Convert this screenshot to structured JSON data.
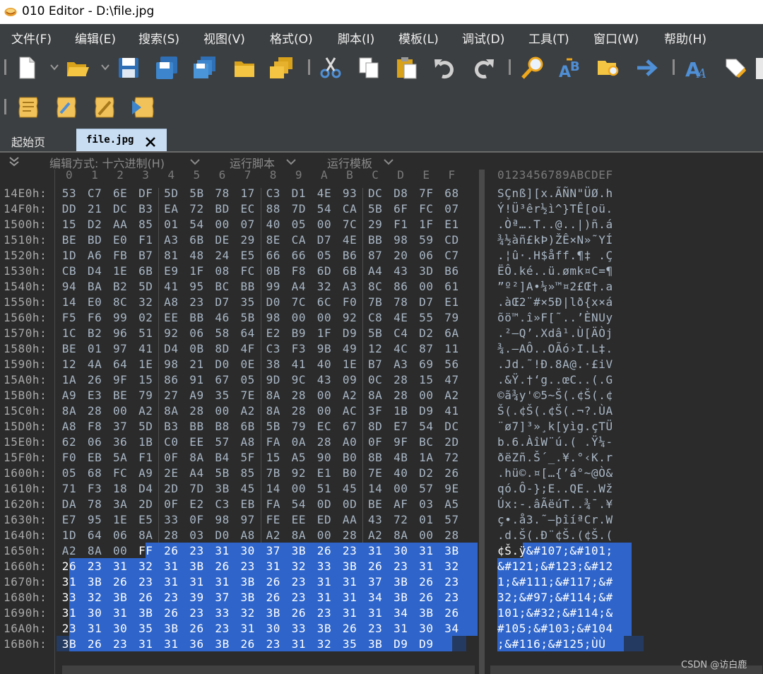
{
  "window": {
    "title": "010 Editor - D:\\file.jpg"
  },
  "menu": [
    "文件(F)",
    "编辑(E)",
    "搜索(S)",
    "视图(V)",
    "格式(O)",
    "脚本(I)",
    "模板(L)",
    "调试(D)",
    "工具(T)",
    "窗口(W)",
    "帮助(H)"
  ],
  "toolbar": {
    "row1": [
      "new-file-icon",
      "open-folder-icon",
      "save-icon",
      "save-as-icon",
      "save-all-icon",
      "folder-icon",
      "open-workspace-icon",
      "cut-icon",
      "copy-icon",
      "paste-icon",
      "undo-icon",
      "redo-icon",
      "find-icon",
      "replace-icon",
      "find-in-files-icon",
      "goto-icon",
      "font-icon",
      "highlight-icon"
    ],
    "row2": [
      "run-script-icon",
      "script-edit-icon",
      "template-icon",
      "run-template-icon"
    ]
  },
  "tabs": {
    "home": "起始页",
    "file": "file.jpg"
  },
  "editor": {
    "edit_mode": "编辑方式: 十六进制(H)",
    "run_script": "运行脚本",
    "run_template": "运行模板",
    "hex_header": [
      "0",
      "1",
      "2",
      "3",
      "4",
      "5",
      "6",
      "7",
      "8",
      "9",
      "A",
      "B",
      "C",
      "D",
      "E",
      "F"
    ],
    "ascii_header": "0123456789ABCDEF",
    "rows": [
      {
        "addr": "14E0h:",
        "hex": [
          "53",
          "C7",
          "6E",
          "DF",
          "5D",
          "5B",
          "78",
          "17",
          "C3",
          "D1",
          "4E",
          "93",
          "DC",
          "D8",
          "7F",
          "68"
        ],
        "ascii": "SÇnß][x.ÃÑN\"ÜØ.h"
      },
      {
        "addr": "14F0h:",
        "hex": [
          "DD",
          "21",
          "DC",
          "B3",
          "EA",
          "72",
          "BD",
          "EC",
          "88",
          "7D",
          "54",
          "CA",
          "5B",
          "6F",
          "FC",
          "07"
        ],
        "ascii": "Ý!Ü³êr½ì^}TÊ[oü."
      },
      {
        "addr": "1500h:",
        "hex": [
          "15",
          "D2",
          "AA",
          "85",
          "01",
          "54",
          "00",
          "07",
          "40",
          "05",
          "00",
          "7C",
          "29",
          "F1",
          "1F",
          "E1"
        ],
        "ascii": ".Òª….T..@..|)ñ.á"
      },
      {
        "addr": "1510h:",
        "hex": [
          "BE",
          "BD",
          "E0",
          "F1",
          "A3",
          "6B",
          "DE",
          "29",
          "8E",
          "CA",
          "D7",
          "4E",
          "BB",
          "98",
          "59",
          "CD"
        ],
        "ascii": "¾½àñ£kÞ)ŽÊ×N»˜YÍ"
      },
      {
        "addr": "1520h:",
        "hex": [
          "1D",
          "A6",
          "FB",
          "B7",
          "81",
          "48",
          "24",
          "E5",
          "66",
          "66",
          "05",
          "B6",
          "87",
          "20",
          "06",
          "C7"
        ],
        "ascii": ".¦û·.H$åff.¶‡ .Ç"
      },
      {
        "addr": "1530h:",
        "hex": [
          "CB",
          "D4",
          "1E",
          "6B",
          "E9",
          "1F",
          "08",
          "FC",
          "0B",
          "F8",
          "6D",
          "6B",
          "A4",
          "43",
          "3D",
          "B6"
        ],
        "ascii": "ËÔ.ké..ü.ømk¤C=¶"
      },
      {
        "addr": "1540h:",
        "hex": [
          "94",
          "BA",
          "B2",
          "5D",
          "41",
          "95",
          "BC",
          "BB",
          "99",
          "A4",
          "32",
          "A3",
          "8C",
          "86",
          "00",
          "61"
        ],
        "ascii": "”º²]A•¼»™¤2£Œ†.a"
      },
      {
        "addr": "1550h:",
        "hex": [
          "14",
          "E0",
          "8C",
          "32",
          "A8",
          "23",
          "D7",
          "35",
          "D0",
          "7C",
          "6C",
          "F0",
          "7B",
          "78",
          "D7",
          "E1"
        ],
        "ascii": ".àŒ2¨#×5Ð|lð{x×á"
      },
      {
        "addr": "1560h:",
        "hex": [
          "F5",
          "F6",
          "99",
          "02",
          "EE",
          "BB",
          "46",
          "5B",
          "98",
          "00",
          "00",
          "92",
          "C8",
          "4E",
          "55",
          "79"
        ],
        "ascii": "õö™.î»F[˜..’ÈNUy"
      },
      {
        "addr": "1570h:",
        "hex": [
          "1C",
          "B2",
          "96",
          "51",
          "92",
          "06",
          "58",
          "64",
          "E2",
          "B9",
          "1F",
          "D9",
          "5B",
          "C4",
          "D2",
          "6A"
        ],
        "ascii": ".²–Q’.Xdâ¹.Ù[ÄÒj"
      },
      {
        "addr": "1580h:",
        "hex": [
          "BE",
          "01",
          "97",
          "41",
          "D4",
          "0B",
          "8D",
          "4F",
          "C3",
          "F3",
          "9B",
          "49",
          "12",
          "4C",
          "87",
          "11"
        ],
        "ascii": "¾.—AÔ..OÃó›I.L‡."
      },
      {
        "addr": "1590h:",
        "hex": [
          "12",
          "4A",
          "64",
          "1E",
          "98",
          "21",
          "D0",
          "0E",
          "38",
          "41",
          "40",
          "1E",
          "B7",
          "A3",
          "69",
          "56"
        ],
        "ascii": ".Jd.˜!Ð.8A@.·£iV"
      },
      {
        "addr": "15A0h:",
        "hex": [
          "1A",
          "26",
          "9F",
          "15",
          "86",
          "91",
          "67",
          "05",
          "9D",
          "9C",
          "43",
          "09",
          "0C",
          "28",
          "15",
          "47"
        ],
        "ascii": ".&Ÿ.†‘g..œC..(.G"
      },
      {
        "addr": "15B0h:",
        "hex": [
          "A9",
          "E3",
          "BE",
          "79",
          "27",
          "A9",
          "35",
          "7E",
          "8A",
          "28",
          "00",
          "A2",
          "8A",
          "28",
          "00",
          "A2"
        ],
        "ascii": "©ã¾y'©5~Š(.¢Š(.¢"
      },
      {
        "addr": "15C0h:",
        "hex": [
          "8A",
          "28",
          "00",
          "A2",
          "8A",
          "28",
          "00",
          "A2",
          "8A",
          "28",
          "00",
          "AC",
          "3F",
          "1B",
          "D9",
          "41"
        ],
        "ascii": "Š(.¢Š(.¢Š(.¬?.ÙA"
      },
      {
        "addr": "15D0h:",
        "hex": [
          "A8",
          "F8",
          "37",
          "5D",
          "B3",
          "BB",
          "B8",
          "6B",
          "5B",
          "79",
          "EC",
          "67",
          "8D",
          "E7",
          "54",
          "DC"
        ],
        "ascii": "¨ø7]³»¸k[yìg.çTÜ"
      },
      {
        "addr": "15E0h:",
        "hex": [
          "62",
          "06",
          "36",
          "1B",
          "C0",
          "EE",
          "57",
          "A8",
          "FA",
          "0A",
          "28",
          "A0",
          "0F",
          "9F",
          "BC",
          "2D"
        ],
        "ascii": "b.6.ÀîW¨ú.( .Ÿ¼-"
      },
      {
        "addr": "15F0h:",
        "hex": [
          "F0",
          "EB",
          "5A",
          "F1",
          "0F",
          "8A",
          "B4",
          "5F",
          "15",
          "A5",
          "90",
          "B0",
          "8B",
          "4B",
          "1A",
          "72"
        ],
        "ascii": "ðëZñ.Š´_.¥.°‹K.r"
      },
      {
        "addr": "1600h:",
        "hex": [
          "05",
          "68",
          "FC",
          "A9",
          "2E",
          "A4",
          "5B",
          "85",
          "7B",
          "92",
          "E1",
          "B0",
          "7E",
          "40",
          "D2",
          "26"
        ],
        "ascii": ".hü©.¤[…{’á°~@Ò&"
      },
      {
        "addr": "1610h:",
        "hex": [
          "71",
          "F3",
          "18",
          "D4",
          "2D",
          "7D",
          "3B",
          "45",
          "14",
          "00",
          "51",
          "45",
          "14",
          "00",
          "57",
          "9E"
        ],
        "ascii": "qó.Ô-};E..QE..Wž"
      },
      {
        "addr": "1620h:",
        "hex": [
          "DA",
          "78",
          "3A",
          "2D",
          "0F",
          "E2",
          "C3",
          "EB",
          "FA",
          "54",
          "0D",
          "0D",
          "BE",
          "AF",
          "03",
          "A5"
        ],
        "ascii": "Úx:-.âÃëúT..¾¯.¥"
      },
      {
        "addr": "1630h:",
        "hex": [
          "E7",
          "95",
          "1E",
          "E5",
          "33",
          "0F",
          "98",
          "97",
          "FE",
          "EE",
          "ED",
          "AA",
          "43",
          "72",
          "01",
          "57"
        ],
        "ascii": "ç•.å3.˜—þîíªCr.W"
      },
      {
        "addr": "1640h:",
        "hex": [
          "1D",
          "64",
          "06",
          "8A",
          "28",
          "03",
          "D0",
          "A8",
          "A2",
          "8A",
          "00",
          "28",
          "A2",
          "8A",
          "00",
          "28"
        ],
        "ascii": ".d.Š(.Ð¨¢Š.(¢Š.("
      },
      {
        "addr": "1650h:",
        "hex": [
          "A2",
          "8A",
          "00",
          "FF",
          "26",
          "23",
          "31",
          "30",
          "37",
          "3B",
          "26",
          "23",
          "31",
          "30",
          "31",
          "3B"
        ],
        "ascii": "¢Š.ÿ&#107;&#101;"
      },
      {
        "addr": "1660h:",
        "hex": [
          "26",
          "23",
          "31",
          "32",
          "31",
          "3B",
          "26",
          "23",
          "31",
          "32",
          "33",
          "3B",
          "26",
          "23",
          "31",
          "32"
        ],
        "ascii": "&#121;&#123;&#12"
      },
      {
        "addr": "1670h:",
        "hex": [
          "31",
          "3B",
          "26",
          "23",
          "31",
          "31",
          "31",
          "3B",
          "26",
          "23",
          "31",
          "31",
          "37",
          "3B",
          "26",
          "23"
        ],
        "ascii": "1;&#111;&#117;&#"
      },
      {
        "addr": "1680h:",
        "hex": [
          "33",
          "32",
          "3B",
          "26",
          "23",
          "39",
          "37",
          "3B",
          "26",
          "23",
          "31",
          "31",
          "34",
          "3B",
          "26",
          "23"
        ],
        "ascii": "32;&#97;&#114;&#"
      },
      {
        "addr": "1690h:",
        "hex": [
          "31",
          "30",
          "31",
          "3B",
          "26",
          "23",
          "33",
          "32",
          "3B",
          "26",
          "23",
          "31",
          "31",
          "34",
          "3B",
          "26"
        ],
        "ascii": "101;&#32;&#114;&"
      },
      {
        "addr": "16A0h:",
        "hex": [
          "23",
          "31",
          "30",
          "35",
          "3B",
          "26",
          "23",
          "31",
          "30",
          "33",
          "3B",
          "26",
          "23",
          "31",
          "30",
          "34"
        ],
        "ascii": "#105;&#103;&#104"
      },
      {
        "addr": "16B0h:",
        "hex": [
          "3B",
          "26",
          "23",
          "31",
          "31",
          "36",
          "3B",
          "26",
          "23",
          "31",
          "32",
          "35",
          "3B",
          "D9",
          "D9",
          ""
        ],
        "ascii": ";&#116;&#125;ÙÙ"
      }
    ]
  },
  "watermark": "CSDN @访白鹿",
  "colors": {
    "selection": "#2f65ca",
    "chrome": "#3c3f41",
    "editor_bg": "#2b2b2b",
    "active_tab": "#c8ddf2"
  }
}
